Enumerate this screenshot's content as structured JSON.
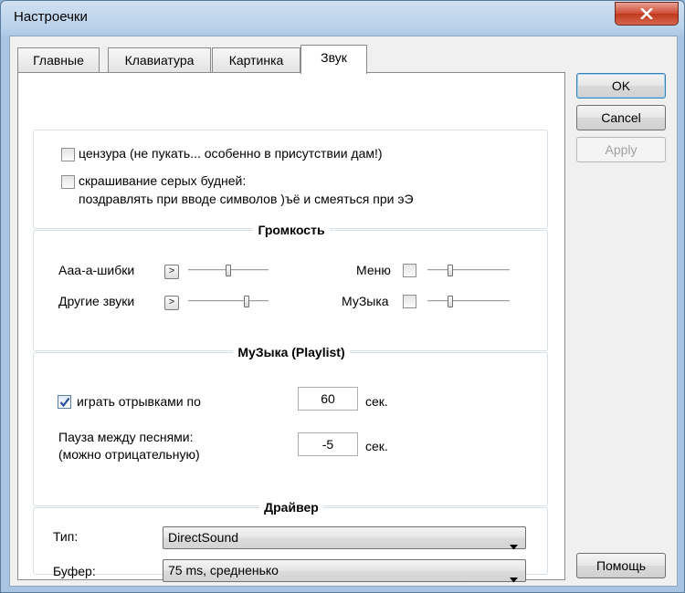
{
  "window": {
    "title": "Настроечки"
  },
  "tabs": [
    {
      "label": "Главные"
    },
    {
      "label": "Клавиатура"
    },
    {
      "label": "Картинка"
    },
    {
      "label": "Звук",
      "active": true
    }
  ],
  "options": {
    "censorship": {
      "label": "цензура (не пукать... особенно в присутствии дам!)",
      "checked": false
    },
    "gray_days": {
      "label_line1": "скрашивание серых будней:",
      "label_line2": "поздравлять при вводе символов  )ъё  и смеяться при  эЭ",
      "checked": false
    }
  },
  "volume": {
    "title": "Громкость",
    "errors_label": "Ааа-а-шибки",
    "other_label": "Другие звуки",
    "menu_label": "Меню",
    "music_label": "МуЗыка",
    "play_glyph": ">",
    "errors_level": 0.5,
    "other_level": 0.74,
    "menu_level": 0.26,
    "music_level": 0.26,
    "menu_checked": false,
    "music_checked": false
  },
  "playlist": {
    "title": "МуЗыка (Playlist)",
    "fragments_label": "играть отрывками по",
    "fragments_checked": true,
    "fragments_value": "60",
    "fragments_unit": "сек.",
    "pause_label_line1": "Пауза между песнями:",
    "pause_label_line2": "(можно отрицательную)",
    "pause_value": "-5",
    "pause_unit": "сек."
  },
  "driver": {
    "title": "Драйвер",
    "type_label": "Тип:",
    "type_value": "DirectSound",
    "buffer_label": "Буфер:",
    "buffer_value": "75 ms, средненько"
  },
  "buttons": {
    "ok": "OK",
    "cancel": "Cancel",
    "apply": "Apply",
    "help": "Помощь"
  },
  "colors": {
    "accent": "#3c7fb1",
    "close_button": "#c0391f",
    "checkmark": "#2b4e9e"
  }
}
